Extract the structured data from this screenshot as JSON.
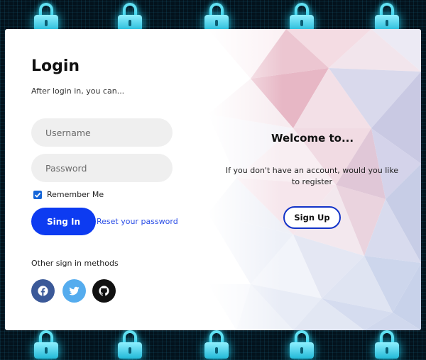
{
  "login": {
    "title": "Login",
    "subtitle": "After login in, you can...",
    "username_placeholder": "Username",
    "password_placeholder": "Password",
    "remember_label": "Remember Me",
    "remember_checked": true,
    "signin_label": "Sing In",
    "reset_label": "Reset your password",
    "other_methods_label": "Other sign in methods",
    "social": [
      {
        "name": "facebook-icon",
        "color": "#3b5998"
      },
      {
        "name": "twitter-icon",
        "color": "#55acee"
      },
      {
        "name": "github-icon",
        "color": "#111111"
      }
    ]
  },
  "welcome": {
    "title": "Welcome to...",
    "text": "If you don't have an account, would you like to register",
    "signup_label": "Sign Up"
  },
  "colors": {
    "primary": "#0d3bf1",
    "link": "#2a4de6",
    "field_bg": "#efefef",
    "lock_glow": "#63e1f2"
  }
}
